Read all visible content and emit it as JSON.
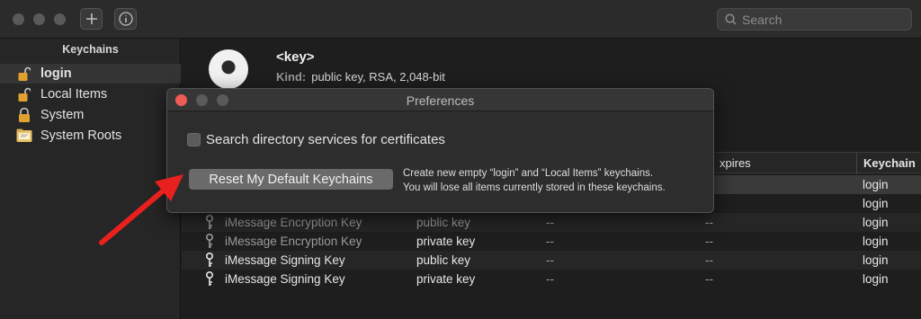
{
  "toolbar": {
    "add_icon": "plus-icon",
    "info_icon": "info-icon",
    "search_placeholder": "Search"
  },
  "sidebar": {
    "header": "Keychains",
    "items": [
      {
        "label": "login",
        "icon": "unlocked-padlock-icon",
        "selected": true
      },
      {
        "label": "Local Items",
        "icon": "unlocked-padlock-icon",
        "selected": false
      },
      {
        "label": "System",
        "icon": "locked-padlock-icon",
        "selected": false
      },
      {
        "label": "System Roots",
        "icon": "certificate-folder-icon",
        "selected": false
      }
    ]
  },
  "detail": {
    "title": "<key>",
    "kind_label": "Kind:",
    "kind_value": "public key, RSA, 2,048-bit"
  },
  "table": {
    "columns": [
      "xpires",
      "Keychain"
    ],
    "rows": [
      {
        "name": "",
        "kind": "",
        "date": "",
        "expires": "",
        "keychain": "login"
      },
      {
        "name": "",
        "kind": "",
        "date": "",
        "expires": "",
        "keychain": "login"
      },
      {
        "name": "iMessage Encryption Key",
        "kind": "public key",
        "date": "--",
        "expires": "--",
        "keychain": "login"
      },
      {
        "name": "iMessage Encryption Key",
        "kind": "private key",
        "date": "--",
        "expires": "--",
        "keychain": "login"
      },
      {
        "name": "iMessage Signing Key",
        "kind": "public key",
        "date": "--",
        "expires": "--",
        "keychain": "login"
      },
      {
        "name": "iMessage Signing Key",
        "kind": "private key",
        "date": "--",
        "expires": "--",
        "keychain": "login"
      }
    ]
  },
  "preferences": {
    "title": "Preferences",
    "checkbox_label": "Search directory services for certificates",
    "checkbox_checked": false,
    "reset_button": "Reset My Default Keychains",
    "reset_description_line1": "Create new empty “login” and “Local Items” keychains.",
    "reset_description_line2": "You will lose all items currently stored in these keychains."
  },
  "colors": {
    "annotation_arrow": "#e8211f",
    "close_button": "#ee5b54"
  }
}
